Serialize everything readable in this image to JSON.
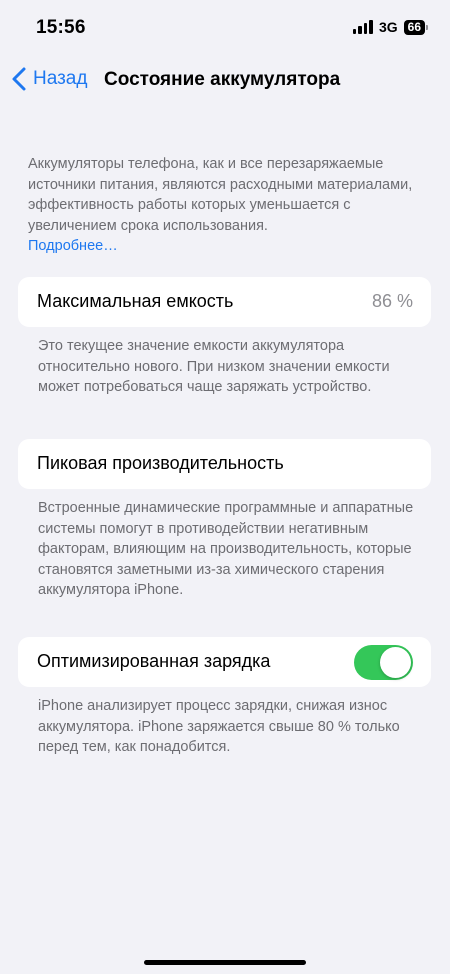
{
  "status_bar": {
    "time": "15:56",
    "network": "3G",
    "battery_level": "66"
  },
  "nav": {
    "back_label": "Назад",
    "title": "Состояние аккумулятора"
  },
  "intro": {
    "text": "Аккумуляторы телефона, как и все перезаряжаемые источники питания, являются расходными материалами, эффективность работы которых уменьшается с увеличением срока использования.",
    "link": "Подробнее…"
  },
  "max_capacity": {
    "label": "Максимальная емкость",
    "value": "86 %",
    "footnote": "Это текущее значение емкости аккумулятора относительно нового. При низком значении емкости может потребоваться чаще заряжать устройство."
  },
  "peak_performance": {
    "label": "Пиковая производительность",
    "footnote": "Встроенные динамические программные и аппаратные системы помогут в противодействии негативным факторам, влияющим на производительность, которые становятся заметными из-за химического старения аккумулятора iPhone."
  },
  "optimized_charging": {
    "label": "Оптимизированная зарядка",
    "enabled": true,
    "footnote": "iPhone анализирует процесс зарядки, снижая износ аккумулятора. iPhone заряжается свыше 80 % только перед тем, как понадобится."
  },
  "colors": {
    "accent": "#1e78f0",
    "toggle_on": "#34c759",
    "background": "#f2f2f7",
    "secondary_text": "#6d6d72"
  },
  "icons": {
    "back": "chevron-left-icon",
    "signal": "cellular-signal-icon",
    "battery": "battery-icon"
  }
}
